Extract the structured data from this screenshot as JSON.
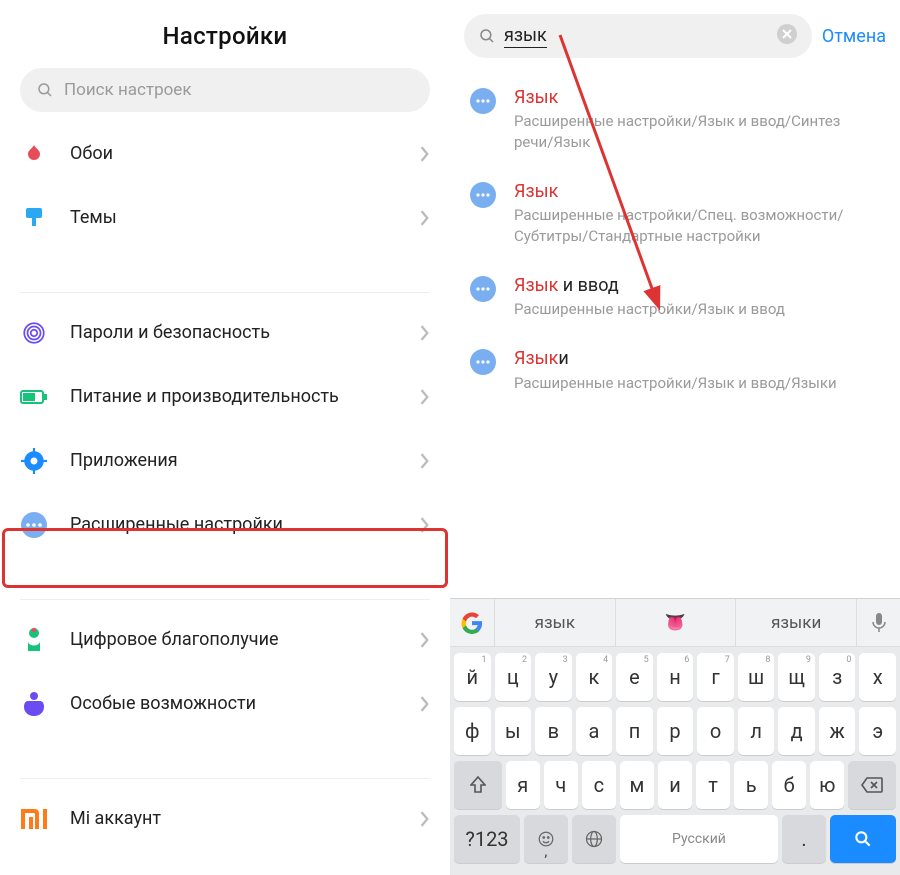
{
  "left": {
    "title": "Настройки",
    "search_placeholder": "Поиск настроек",
    "items": [
      {
        "icon": "wallpaper",
        "label": "Обои"
      },
      {
        "icon": "themes",
        "label": "Темы"
      },
      {
        "sep": true
      },
      {
        "icon": "security",
        "label": "Пароли и безопасность"
      },
      {
        "icon": "battery",
        "label": "Питание и производительность"
      },
      {
        "icon": "apps",
        "label": "Приложения"
      },
      {
        "icon": "advanced",
        "label": "Расширенные настройки",
        "highlighted": true
      },
      {
        "sep": true
      },
      {
        "icon": "wellbeing",
        "label": "Цифровое благополучие"
      },
      {
        "icon": "accessibility",
        "label": "Особые возможности"
      },
      {
        "sep": true
      },
      {
        "icon": "mi",
        "label": "Mi аккаунт"
      }
    ]
  },
  "right": {
    "query": "язык",
    "cancel": "Отмена",
    "results": [
      {
        "title_hl": "Язык",
        "title_rest": "",
        "path": "Расширенные настройки/Язык и ввод/Синтез речи/Язык"
      },
      {
        "title_hl": "Язык",
        "title_rest": "",
        "path": "Расширенные настройки/Спец. возможности/Субтитры/Стандартные настройки"
      },
      {
        "title_hl": "Язык",
        "title_rest": " и ввод",
        "path": "Расширенные настройки/Язык и ввод"
      },
      {
        "title_hl": "Язык",
        "title_rest": "и",
        "path": "Расширенные настройки/Язык и ввод/Языки"
      }
    ]
  },
  "keyboard": {
    "suggestions": [
      "язык",
      "👅",
      "языки"
    ],
    "rows": [
      [
        {
          "k": "й",
          "s": "1"
        },
        {
          "k": "ц",
          "s": "2"
        },
        {
          "k": "у",
          "s": "3"
        },
        {
          "k": "к",
          "s": "4"
        },
        {
          "k": "е",
          "s": "5"
        },
        {
          "k": "н",
          "s": "6"
        },
        {
          "k": "г",
          "s": "7"
        },
        {
          "k": "ш",
          "s": "8"
        },
        {
          "k": "щ",
          "s": "9"
        },
        {
          "k": "з",
          "s": "0"
        },
        {
          "k": "х"
        }
      ],
      [
        {
          "k": "ф"
        },
        {
          "k": "ы"
        },
        {
          "k": "в"
        },
        {
          "k": "а"
        },
        {
          "k": "п"
        },
        {
          "k": "р"
        },
        {
          "k": "о"
        },
        {
          "k": "л"
        },
        {
          "k": "д"
        },
        {
          "k": "ж"
        },
        {
          "k": "э"
        }
      ],
      [
        {
          "k": "shift",
          "fn": true
        },
        {
          "k": "я"
        },
        {
          "k": "ч"
        },
        {
          "k": "с"
        },
        {
          "k": "м"
        },
        {
          "k": "и"
        },
        {
          "k": "т"
        },
        {
          "k": "ь"
        },
        {
          "k": "б"
        },
        {
          "k": "ю"
        },
        {
          "k": "backspace",
          "fn": true
        }
      ]
    ],
    "bottom": {
      "sym": "?123",
      "emoji": "☺",
      "comma": ",",
      "globe": "globe",
      "space": "Русский",
      "dot": ".",
      "search": "search"
    }
  }
}
